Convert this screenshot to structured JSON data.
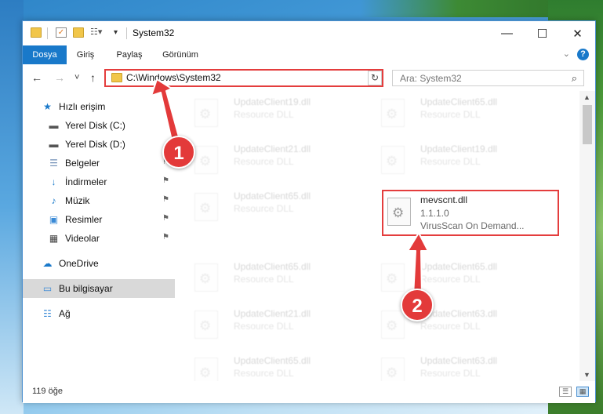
{
  "titlebar": {
    "title": "System32",
    "minimize": "—",
    "maximize": "☐",
    "close": "✕"
  },
  "ribbon": {
    "tabs": [
      "Dosya",
      "Giriş",
      "Paylaş",
      "Görünüm"
    ],
    "expand": "⌄",
    "help": "?"
  },
  "navbar": {
    "back": "←",
    "forward": "→",
    "recent": "˅",
    "up": "↑",
    "address": "C:\\Windows\\System32",
    "address_chevron": "∨",
    "refresh": "↻",
    "search_placeholder": "Ara: System32",
    "search_icon": "⌕"
  },
  "sidebar": {
    "items": [
      {
        "label": "Hızlı erişim",
        "icon": "star-icon",
        "glyph": "★",
        "color": "#1979ca"
      },
      {
        "label": "Yerel Disk (C:)",
        "icon": "drive-icon",
        "glyph": "▬",
        "color": "#555555"
      },
      {
        "label": "Yerel Disk (D:)",
        "icon": "drive-icon",
        "glyph": "▬",
        "color": "#555555"
      },
      {
        "label": "Belgeler",
        "icon": "documents-icon",
        "glyph": "☰",
        "color": "#6e8db5",
        "pinned": true
      },
      {
        "label": "İndirmeler",
        "icon": "downloads-icon",
        "glyph": "↓",
        "color": "#1979ca",
        "pinned": true
      },
      {
        "label": "Müzik",
        "icon": "music-icon",
        "glyph": "♪",
        "color": "#1979ca",
        "pinned": true
      },
      {
        "label": "Resimler",
        "icon": "pictures-icon",
        "glyph": "▣",
        "color": "#3a8ad6",
        "pinned": true
      },
      {
        "label": "Videolar",
        "icon": "videos-icon",
        "glyph": "▦",
        "color": "#444444",
        "pinned": true
      },
      {
        "label": "OneDrive",
        "icon": "onedrive-icon",
        "glyph": "☁",
        "color": "#1979ca"
      },
      {
        "label": "Bu bilgisayar",
        "icon": "computer-icon",
        "glyph": "▭",
        "color": "#3a8ad6"
      },
      {
        "label": "Ağ",
        "icon": "network-icon",
        "glyph": "☷",
        "color": "#3a8ad6"
      }
    ],
    "pin_glyph": "⚑"
  },
  "files": {
    "faded": [
      {
        "name": "UpdateClient19.dll",
        "type": "Resource DLL"
      },
      {
        "name": "UpdateClient65.dll",
        "type": "Resource DLL"
      },
      {
        "name": "UpdateClient21.dll",
        "type": "Resource DLL"
      },
      {
        "name": "UpdateClient19.dll",
        "type": "Resource DLL"
      },
      {
        "name": "UpdateClient65.dll",
        "type": "Resource DLL"
      },
      {
        "name": "UpdateClient65.dll",
        "type": "Resource DLL"
      },
      {
        "name": "UpdateClient65.dll",
        "type": "Resource DLL"
      },
      {
        "name": "UpdateClient21.dll",
        "type": "Resource DLL"
      },
      {
        "name": "UpdateClient63.dll",
        "type": "Resource DLL"
      },
      {
        "name": "UpdateClient65.dll",
        "type": "Resource DLL"
      },
      {
        "name": "UpdateClient63.dll",
        "type": "Resource DLL"
      }
    ],
    "highlighted": {
      "name": "mevscnt.dll",
      "version": "1.1.1.0",
      "description": "VirusScan On Demand..."
    },
    "gear_glyph": "⚙"
  },
  "scroll": {
    "up": "▲",
    "down": "▼"
  },
  "status": {
    "count": "119 öğe",
    "details_view": "☰",
    "tiles_view": "▦"
  },
  "annotations": {
    "badge1": "1",
    "badge2": "2"
  },
  "colors": {
    "accent": "#1979ca",
    "highlight": "#e43d3d"
  }
}
